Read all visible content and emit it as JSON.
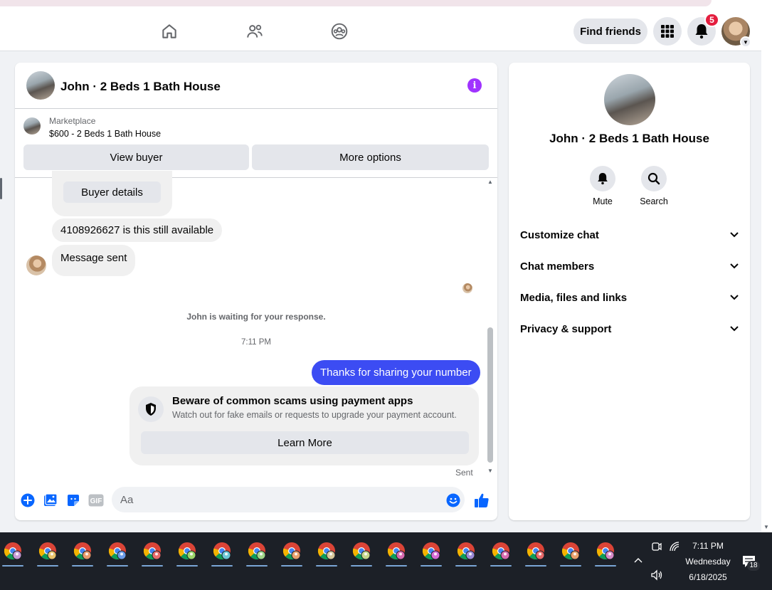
{
  "header": {
    "find_friends": "Find friends",
    "notification_count": "5",
    "nav_icons": [
      "home-icon",
      "friends-icon",
      "groups-icon"
    ],
    "menu_icon": "grid-menu-icon",
    "bell_icon": "bell-icon"
  },
  "chat": {
    "title": "John · 2 Beds 1 Bath House",
    "marketplace": {
      "label": "Marketplace",
      "item": "$600 - 2 Beds 1 Bath House",
      "view_buyer": "View buyer",
      "more_options": "More options"
    },
    "messages": {
      "buyer_details": "Buyer details",
      "msg1": "4108926627 is this still available",
      "msg2": "Message sent",
      "waiting": "John is waiting for your response.",
      "time": "7:11 PM",
      "outgoing": "Thanks for sharing your number",
      "warning_title": "Beware of common scams using payment apps",
      "warning_body": "Watch out for fake emails or requests to upgrade your payment account.",
      "learn_more": "Learn More",
      "status": "Sent"
    },
    "composer": {
      "placeholder": "Aa"
    }
  },
  "sidebar": {
    "title": "John · 2 Beds 1 Bath House",
    "mute": "Mute",
    "search": "Search",
    "sections": [
      "Customize chat",
      "Chat members",
      "Media, files and links",
      "Privacy & support"
    ]
  },
  "taskbar": {
    "time": "7:11 PM",
    "day": "Wednesday",
    "date": "6/18/2025",
    "notif_count": "18"
  },
  "colors": {
    "brand": "#0866ff",
    "outgoing_bubble": "#3c4cf3",
    "info": "#a033ff",
    "badge": "#e41e3f"
  }
}
